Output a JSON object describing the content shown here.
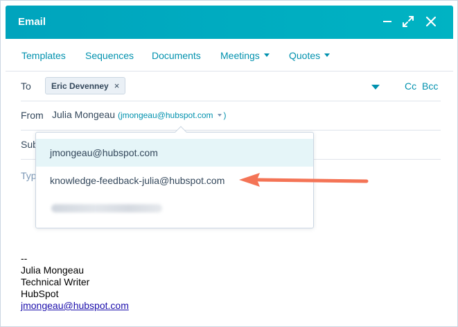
{
  "header": {
    "title": "Email",
    "accent_color": "#00a4bd",
    "buttons": [
      "minimize-icon",
      "expand-icon",
      "close-icon"
    ]
  },
  "toolbar": {
    "templates": "Templates",
    "sequences": "Sequences",
    "documents": "Documents",
    "meetings": "Meetings",
    "quotes": "Quotes"
  },
  "to_row": {
    "label": "To",
    "recipient": "Eric Devenney",
    "remove_glyph": "×",
    "cc": "Cc",
    "bcc": "Bcc"
  },
  "from_row": {
    "label": "From",
    "name": "Julia Mongeau",
    "email": "jmongeau@hubspot.com"
  },
  "subject_row": {
    "label_partial": "Sub"
  },
  "body": {
    "placeholder_partial": "Typ"
  },
  "from_dropdown": {
    "options": [
      {
        "label": "jmongeau@hubspot.com",
        "selected": true
      },
      {
        "label": "knowledge-feedback-julia@hubspot.com",
        "selected": false
      }
    ],
    "highlight_color": "#e5f5f8"
  },
  "annotation": {
    "arrow_color": "#f47456"
  },
  "signature": {
    "separator": "--",
    "name": "Julia Mongeau",
    "role": "Technical Writer",
    "company": "HubSpot",
    "email": "jmongeau@hubspot.com"
  }
}
